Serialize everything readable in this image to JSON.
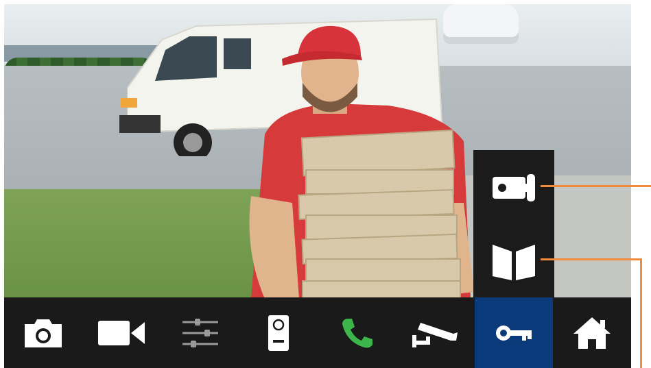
{
  "colors": {
    "toolbar_bg": "#1a1a1a",
    "active_tab_bg": "#0b3a7a",
    "call_icon": "#3cb54a",
    "icon_default": "#ffffff",
    "icon_dimmed": "#9a9a9a",
    "callout_line": "#f08a3c"
  },
  "camera_feed": {
    "scene": "delivery-person-holding-pizza-boxes",
    "icon": "camera-feed"
  },
  "side_panel": {
    "buttons": [
      {
        "icon": "door-lock-icon",
        "highlighted": true
      },
      {
        "icon": "gate-icon",
        "highlighted": true
      }
    ]
  },
  "toolbar": {
    "active_index": 6,
    "buttons": [
      {
        "icon": "camera-snapshot-icon"
      },
      {
        "icon": "video-record-icon"
      },
      {
        "icon": "settings-sliders-icon",
        "dimmed": true
      },
      {
        "icon": "door-station-icon"
      },
      {
        "icon": "phone-answer-icon"
      },
      {
        "icon": "cctv-camera-icon"
      },
      {
        "icon": "key-icon",
        "active": true
      },
      {
        "icon": "home-icon"
      }
    ]
  }
}
